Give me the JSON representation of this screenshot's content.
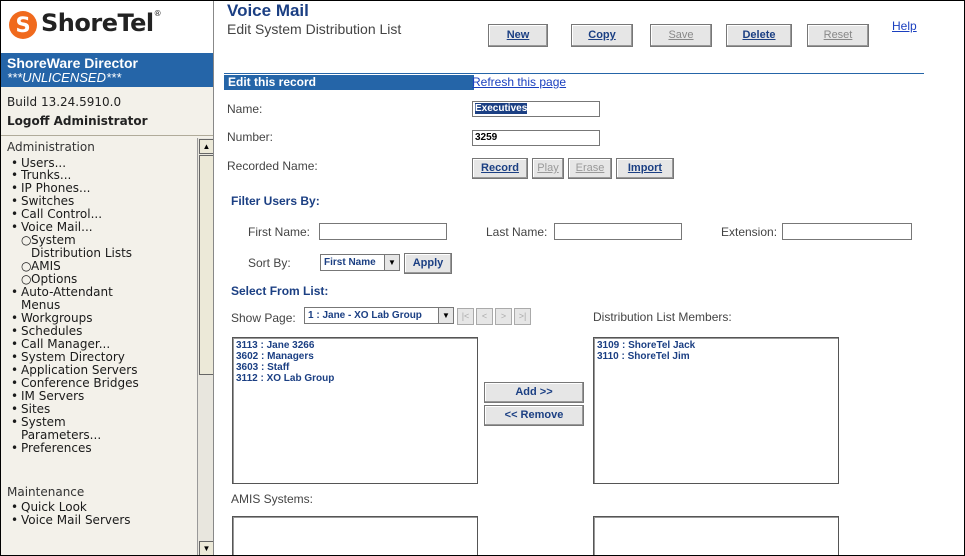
{
  "brand": {
    "logo_text": "ShoreTel",
    "logo_mark": "S",
    "trademark": "®",
    "product": "ShoreWare Director",
    "license": "***UNLICENSED***"
  },
  "session": {
    "build": "Build 13.24.5910.0",
    "logoff": "Logoff Administrator"
  },
  "nav": {
    "administration": "Administration",
    "items": [
      {
        "bullet": "•",
        "label": "Users..."
      },
      {
        "bullet": "•",
        "label": "Trunks..."
      },
      {
        "bullet": "•",
        "label": "IP Phones..."
      },
      {
        "bullet": "•",
        "label": "Switches"
      },
      {
        "bullet": "•",
        "label": "Call Control..."
      },
      {
        "bullet": "•",
        "label": "Voice Mail..."
      },
      {
        "bullet": "○",
        "label": "System"
      },
      {
        "bullet": "",
        "label": "Distribution Lists"
      },
      {
        "bullet": "○",
        "label": "AMIS"
      },
      {
        "bullet": "○",
        "label": "Options"
      },
      {
        "bullet": "•",
        "label": "Auto-Attendant"
      },
      {
        "bullet": "",
        "label": "Menus"
      },
      {
        "bullet": "•",
        "label": "Workgroups"
      },
      {
        "bullet": "•",
        "label": "Schedules"
      },
      {
        "bullet": "•",
        "label": "Call Manager..."
      },
      {
        "bullet": "•",
        "label": "System Directory"
      },
      {
        "bullet": "•",
        "label": "Application Servers"
      },
      {
        "bullet": "•",
        "label": "Conference Bridges"
      },
      {
        "bullet": "•",
        "label": "IM Servers"
      },
      {
        "bullet": "•",
        "label": "Sites"
      },
      {
        "bullet": "•",
        "label": "System"
      },
      {
        "bullet": "",
        "label": "Parameters..."
      },
      {
        "bullet": "•",
        "label": "Preferences"
      }
    ],
    "maintenance": "Maintenance",
    "maintenance_items": [
      {
        "bullet": "•",
        "label": "Quick Look"
      },
      {
        "bullet": "•",
        "label": "Voice Mail Servers"
      }
    ]
  },
  "page": {
    "title": "Voice Mail",
    "subtitle": "Edit System Distribution List",
    "help": "Help",
    "toolbar": {
      "new": "New",
      "copy": "Copy",
      "save": "Save",
      "delete": "Delete",
      "reset": "Reset"
    },
    "edit_record": "Edit this record",
    "refresh": "Refresh this page"
  },
  "form": {
    "name_label": "Name:",
    "name_value": "Executives",
    "number_label": "Number:",
    "number_value": "3259",
    "recorded_label": "Recorded Name:",
    "record_btn": "Record",
    "play_btn": "Play",
    "erase_btn": "Erase",
    "import_btn": "Import"
  },
  "filter": {
    "heading": "Filter Users By:",
    "first_name_label": "First Name:",
    "last_name_label": "Last Name:",
    "extension_label": "Extension:",
    "sort_by_label": "Sort By:",
    "sort_value": "First Name",
    "apply_btn": "Apply"
  },
  "select": {
    "heading": "Select From List:",
    "show_page_label": "Show Page:",
    "show_page_value": "1 : Jane - XO Lab Group",
    "nav_first": "|<",
    "nav_prev": "<",
    "nav_next": ">",
    "nav_last": ">|",
    "available": [
      "3113 : Jane 3266",
      "3602 : Managers",
      "3603 : Staff",
      "3112 : XO Lab Group"
    ],
    "add_btn": "Add >>",
    "remove_btn": "<< Remove",
    "members_label": "Distribution List Members:",
    "members": [
      "3109 : ShoreTel Jack",
      "3110 : ShoreTel Jim"
    ],
    "amis_label": "AMIS Systems:"
  },
  "icons": {
    "scroll_up": "scroll-up-arrow-icon",
    "scroll_down": "scroll-down-arrow-icon",
    "dropdown": "dropdown-arrow-icon"
  },
  "colors": {
    "brand_orange": "#f06a1d",
    "header_blue": "#2565a8",
    "link_blue": "#1a3fbf",
    "text_navy": "#1b3f83"
  }
}
